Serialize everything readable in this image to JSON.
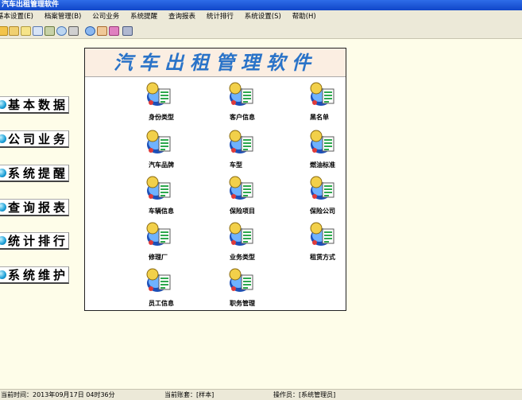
{
  "window": {
    "title": "汽车出租管理软件"
  },
  "menu": [
    "基本设置(E)",
    "档案管理(B)",
    "公司业务",
    "系统提醒",
    "查询报表",
    "统计排行",
    "系统设置(S)",
    "帮助(H)"
  ],
  "toolbar": {
    "icons": [
      "open-folder-icon",
      "notebook-icon",
      "save-icon",
      "calendar-icon",
      "tools-icon",
      "search-icon",
      "print-icon",
      "clipboard-icon",
      "user-icon",
      "paint-icon",
      "exit-icon"
    ]
  },
  "sidebar": [
    "基本数据",
    "公司业务",
    "系统提醒",
    "查询报表",
    "统计排行",
    "系统维护"
  ],
  "banner": {
    "title": "汽车出租管理软件"
  },
  "grid": [
    "身份类型",
    "客户信息",
    "黑名单",
    "汽车品牌",
    "车型",
    "燃油标准",
    "车辆信息",
    "保险项目",
    "保险公司",
    "修理厂",
    "业务类型",
    "租赁方式",
    "员工信息",
    "职务管理"
  ],
  "status": {
    "time": "当前时间：2013年09月17日 04时36分",
    "account": "当前账套：[样本]",
    "operator": "操作员：[系统管理员]"
  }
}
